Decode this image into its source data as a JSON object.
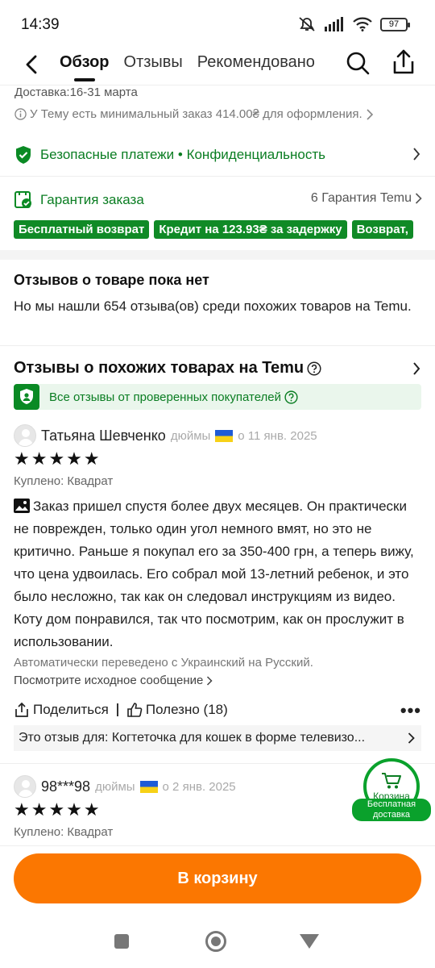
{
  "status": {
    "time": "14:39",
    "battery": "97"
  },
  "nav": {
    "tabs": [
      {
        "label": "Обзор",
        "active": true
      },
      {
        "label": "Отзывы",
        "active": false
      },
      {
        "label": "Рекомендовано",
        "active": false
      }
    ]
  },
  "shipping": {
    "delivery": "Доставка:16-31 марта",
    "min_order": "У Тему есть минимальный заказ 414.00₴ для оформления."
  },
  "security": {
    "text": "Безопасные платежи • Конфиденциальность"
  },
  "guarantee": {
    "title": "Гарантия заказа",
    "right": "6 Гарантия Temu",
    "badges": [
      "Бесплатный возврат",
      "Кредит на 123.93₴ за задержку",
      "Возврат,"
    ]
  },
  "no_reviews": {
    "title": "Отзывов о товаре пока нет",
    "text": "Но мы нашли 654 отзыва(ов) среди похожих товаров на Temu."
  },
  "similar": {
    "title": "Отзывы о похожих товарах на Temu",
    "verified": "Все отзывы от проверенных покупателей"
  },
  "reviews": [
    {
      "name": "Татьяна Шевченко",
      "unit": "дюймы",
      "date": "о 11 янв. 2025",
      "stars": "★★★★★",
      "bought": "Куплено: Квадрат",
      "text": "Заказ пришел спустя более двух месяцев. Он практически не поврежден, только один угол немного вмят, но это не критично. Раньше я покупал его за 350-400 грн, а теперь вижу, что цена удвоилась. Его собрал мой 13-летний ребенок, и это было несложно, так как он следовал инструкциям из видео. Коту дом понравился, так что посмотрим, как он прослужит в использовании.",
      "translated": "Автоматически переведено с Украинский на Русский.",
      "original": "Посмотрите исходное сообщение"
    },
    {
      "name": "98***98",
      "unit": "дюймы",
      "date": "о 2 янв. 2025",
      "stars": "★★★★★",
      "bought": "Куплено: Квадрат"
    }
  ],
  "actions": {
    "share": "Поделиться",
    "helpful": "Полезно (18)",
    "more": "•••"
  },
  "for_item": "Это отзыв для: Когтеточка для кошек в форме телевизо...",
  "cart_float": {
    "label": "Корзина",
    "free": "Бесплатная доставка"
  },
  "bottom": {
    "cart_button": "В корзину"
  },
  "colors": {
    "accent": "#fb7701",
    "green": "#0a7d22",
    "badge_green": "#108a26"
  }
}
